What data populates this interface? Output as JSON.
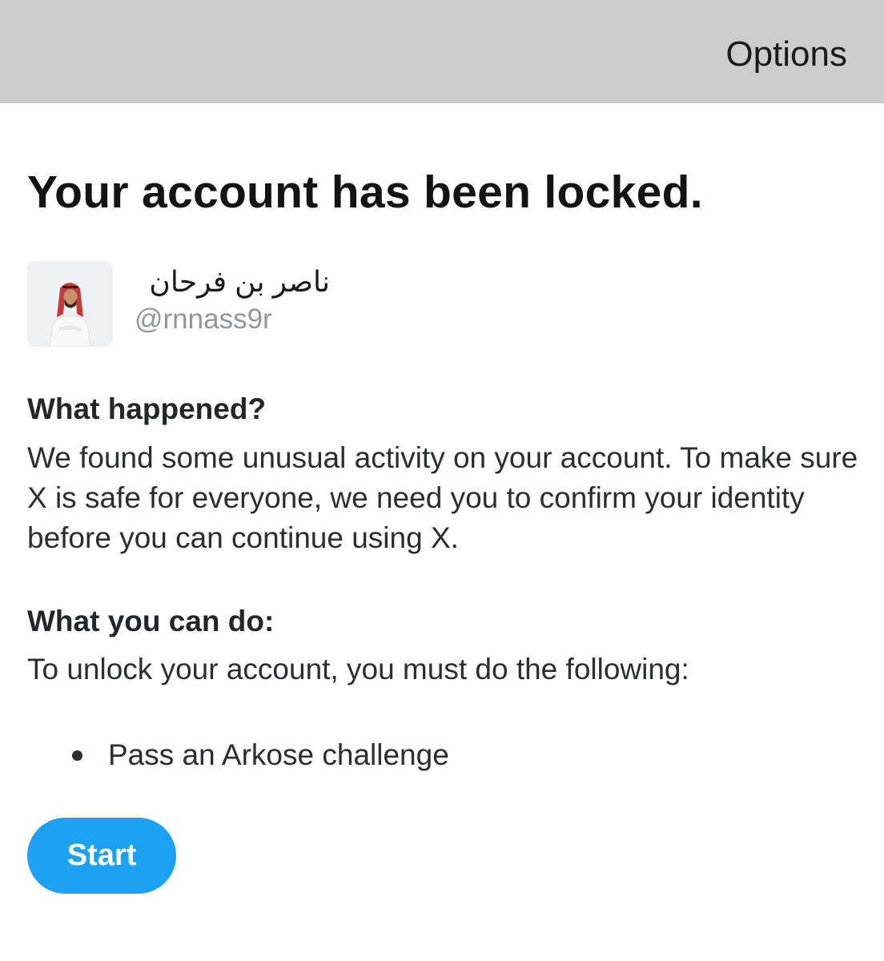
{
  "header": {
    "options_label": "Options",
    "background": "#cccccc"
  },
  "main": {
    "title": "Your account has been locked.",
    "account": {
      "display_name": "ناصر بن فرحان",
      "handle": "@rnnass9r",
      "avatar": "profile-photo"
    },
    "what_happened": {
      "heading": "What happened?",
      "body": "We found some unusual activity on your account. To make sure X is safe for everyone, we need you to confirm your identity before you can continue using X."
    },
    "what_you_can_do": {
      "heading": "What you can do:",
      "body": "To unlock your account, you must do the following:",
      "steps": [
        "Pass an Arkose challenge"
      ]
    },
    "start_button": {
      "label": "Start",
      "color": "#1da1f2"
    }
  }
}
